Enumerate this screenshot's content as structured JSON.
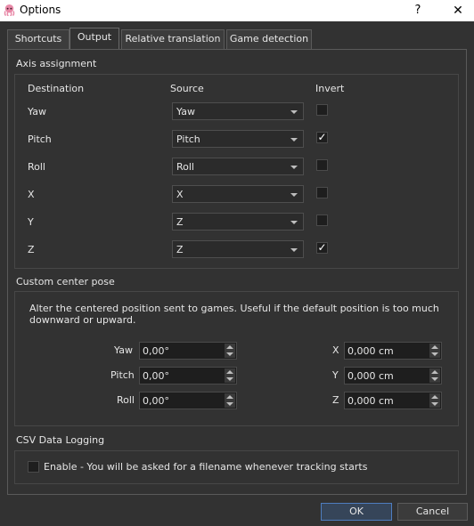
{
  "window": {
    "title": "Options",
    "help_label": "?",
    "close_label": "✕"
  },
  "tabs": [
    {
      "label": "Shortcuts"
    },
    {
      "label": "Output"
    },
    {
      "label": "Relative translation"
    },
    {
      "label": "Game detection"
    }
  ],
  "active_tab": "Output",
  "axis_assignment": {
    "title": "Axis assignment",
    "headers": {
      "destination": "Destination",
      "source": "Source",
      "invert": "Invert"
    },
    "rows": [
      {
        "destination": "Yaw",
        "source": "Yaw",
        "invert": false,
        "invert_mark": ""
      },
      {
        "destination": "Pitch",
        "source": "Pitch",
        "invert": true,
        "invert_mark": "✓"
      },
      {
        "destination": "Roll",
        "source": "Roll",
        "invert": false,
        "invert_mark": ""
      },
      {
        "destination": "X",
        "source": "X",
        "invert": false,
        "invert_mark": ""
      },
      {
        "destination": "Y",
        "source": "Z",
        "invert": false,
        "invert_mark": ""
      },
      {
        "destination": "Z",
        "source": "Z",
        "invert": true,
        "invert_mark": "✓"
      }
    ]
  },
  "custom_center_pose": {
    "title": "Custom center pose",
    "description": "Alter the centered position sent to games. Useful if the default position is too much downward or upward.",
    "yaw": {
      "label": "Yaw",
      "value": "0,00°"
    },
    "pitch": {
      "label": "Pitch",
      "value": "0,00°"
    },
    "roll": {
      "label": "Roll",
      "value": "0,00°"
    },
    "x": {
      "label": "X",
      "value": "0,000 cm"
    },
    "y": {
      "label": "Y",
      "value": "0,000 cm"
    },
    "z": {
      "label": "Z",
      "value": "0,000 cm"
    }
  },
  "csv_logging": {
    "title": "CSV Data Logging",
    "enable_label": "Enable - You will be asked for a filename whenever tracking starts",
    "enabled": false
  },
  "footer": {
    "ok_label": "OK",
    "cancel_label": "Cancel"
  },
  "colors": {
    "background": "#323232",
    "titlebar": "#ffffff",
    "accent_border": "#4e7dbf",
    "text": "#e6e6e6"
  }
}
